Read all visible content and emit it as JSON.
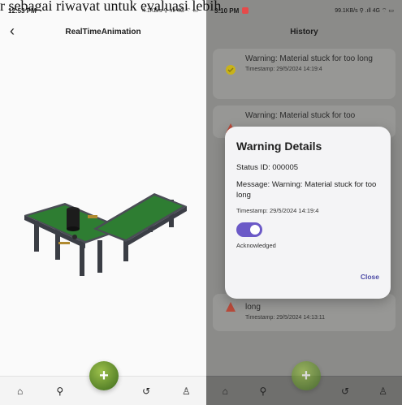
{
  "caption": "r sebagai riwayat untuk evaluasi lebih",
  "left": {
    "status_time": "12:53 PM",
    "status_right": "4.1KB/s ⚲ .ıll 4G ⌔ ▭",
    "title": "RealTimeAnimation",
    "nav": [
      "home-icon",
      "location-icon",
      "history-icon",
      "profile-icon"
    ]
  },
  "right": {
    "status_time": "3:10 PM",
    "status_right": "99.1KB/s ⚲ .ıll 4G ⌔ ▭",
    "title": "History",
    "history": [
      {
        "message": "Warning: Material stuck for too long",
        "timestamp": "Timestamp: 29/5/2024 14:19:4",
        "type": "check"
      },
      {
        "message": "Warning: Material stuck for too",
        "timestamp": "",
        "type": "warning"
      },
      {
        "message": "long",
        "timestamp": "Timestamp: 29/5/2024 14:13:11",
        "type": "warning"
      }
    ],
    "dialog": {
      "title": "Warning Details",
      "status_id": "Status ID: 000005",
      "message": "Message: Warning: Material stuck for too long",
      "timestamp": "Timestamp: 29/5/2024 14:19:4",
      "ack_label": "Acknowledged",
      "close": "Close"
    },
    "nav": [
      "home-icon",
      "location-icon",
      "history-icon",
      "profile-icon"
    ]
  },
  "colors": {
    "accent": "#6b59c7",
    "fab_green": "#4f8a22",
    "warning_red": "#d9443a",
    "check_yellow": "#c8b21a"
  }
}
